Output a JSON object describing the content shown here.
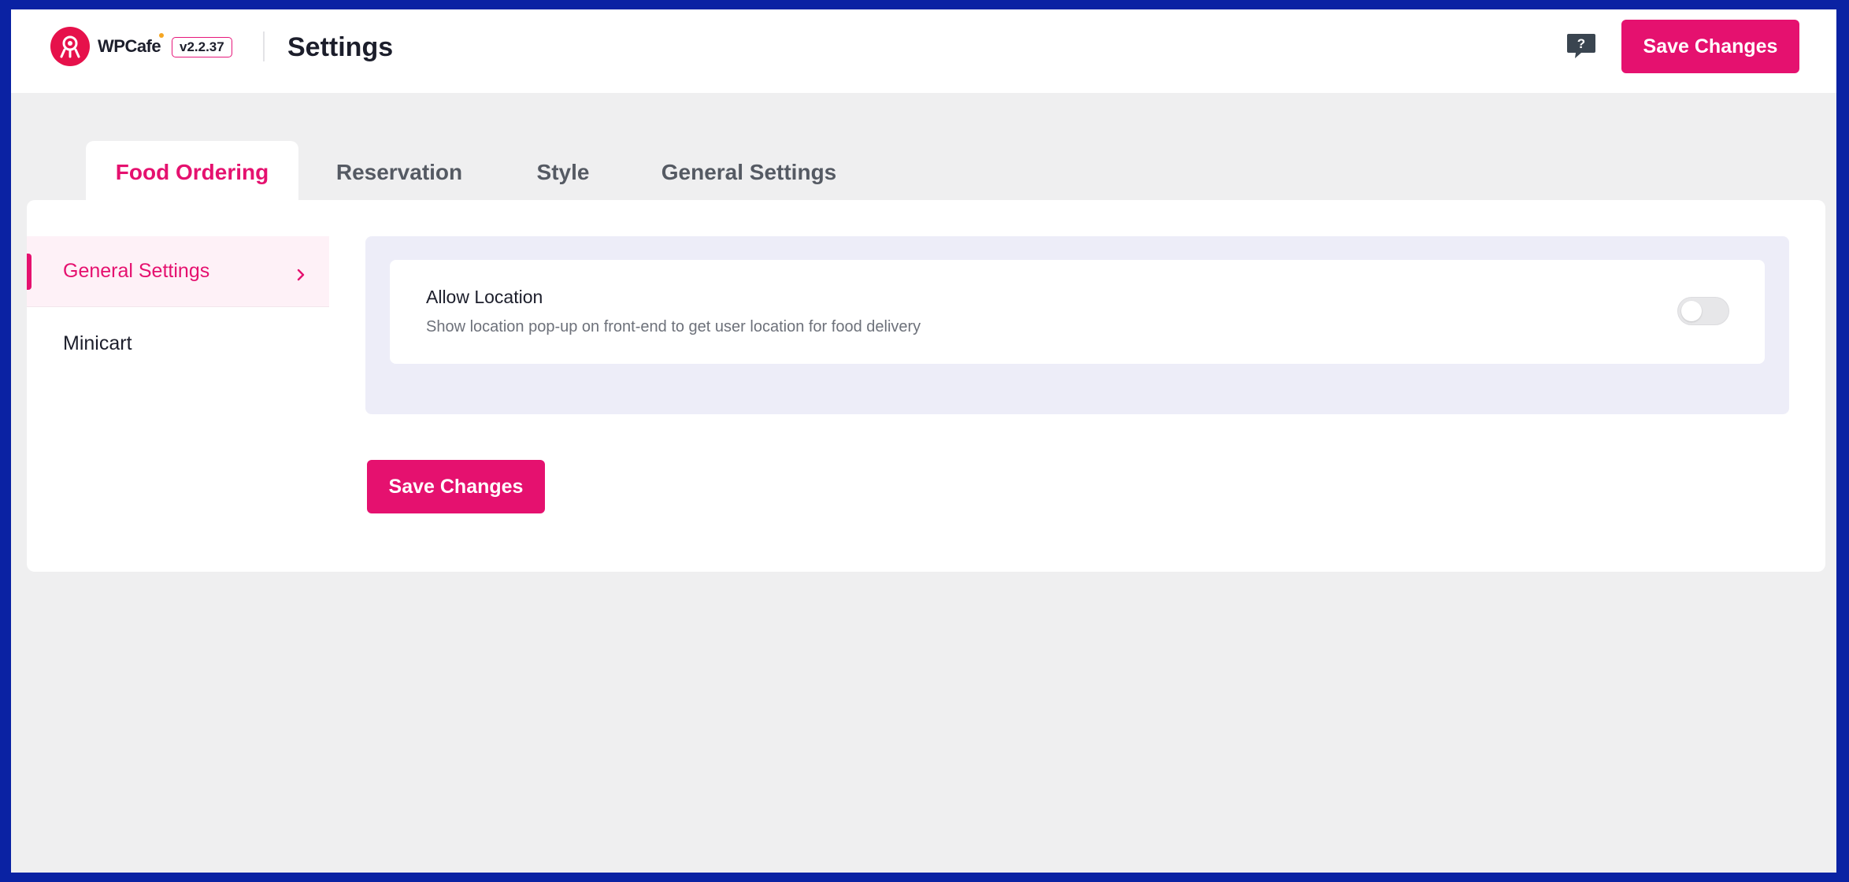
{
  "colors": {
    "accent": "#e5116f",
    "logo": "#e6114b",
    "outer_frame": "#0a22a3",
    "page_background": "#efeff0",
    "settings_box": "#ededf8"
  },
  "header": {
    "brand": "WPCafe",
    "version": "v2.2.37",
    "title": "Settings",
    "help_icon": "question-chat-icon",
    "save_label": "Save Changes"
  },
  "tabs": [
    {
      "label": "Food Ordering",
      "active": true
    },
    {
      "label": "Reservation",
      "active": false
    },
    {
      "label": "Style",
      "active": false
    },
    {
      "label": "General Settings",
      "active": false
    }
  ],
  "sidebar": {
    "items": [
      {
        "label": "General Settings",
        "active": true,
        "icon": "chevron-right-icon"
      },
      {
        "label": "Minicart",
        "active": false
      }
    ]
  },
  "settings": {
    "allow_location": {
      "title": "Allow Location",
      "description": "Show location pop-up on front-end to get user location for food delivery",
      "enabled": false
    }
  },
  "panel": {
    "save_label": "Save Changes"
  }
}
